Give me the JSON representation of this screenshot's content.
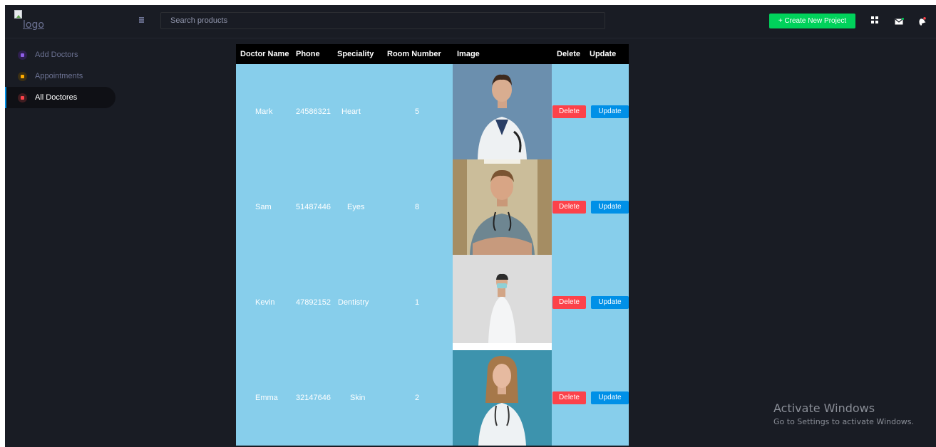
{
  "header": {
    "logo_text": "logo",
    "search_placeholder": "Search products",
    "create_button": "+ Create New Project"
  },
  "sidebar": {
    "items": [
      {
        "label": "Add Doctors",
        "icon": "plus-square-icon",
        "color": "#8f5fe8"
      },
      {
        "label": "Appointments",
        "icon": "calendar-icon",
        "color": "#ffab00"
      },
      {
        "label": "All Doctores",
        "icon": "list-icon",
        "color": "#fc424a"
      }
    ]
  },
  "table": {
    "headers": [
      "Doctor Name",
      "Phone",
      "Speciality",
      "Room Number",
      "Image",
      "Delete",
      "Update"
    ],
    "rows": [
      {
        "name": "Mark",
        "phone": "24586321",
        "speciality": "Heart",
        "room": "5"
      },
      {
        "name": "Sam",
        "phone": "51487446",
        "speciality": "Eyes",
        "room": "8"
      },
      {
        "name": "Kevin",
        "phone": "47892152",
        "speciality": "Dentistry",
        "room": "1"
      },
      {
        "name": "Emma",
        "phone": "32147646",
        "speciality": "Skin",
        "room": "2"
      }
    ],
    "delete_label": "Delete",
    "update_label": "Update"
  },
  "watermark": {
    "title": "Activate Windows",
    "subtitle": "Go to Settings to activate Windows."
  },
  "colors": {
    "background": "#191c24",
    "table_body": "#87ceeb",
    "delete": "#fc424a",
    "update": "#0090e7",
    "create": "#00d25b"
  }
}
